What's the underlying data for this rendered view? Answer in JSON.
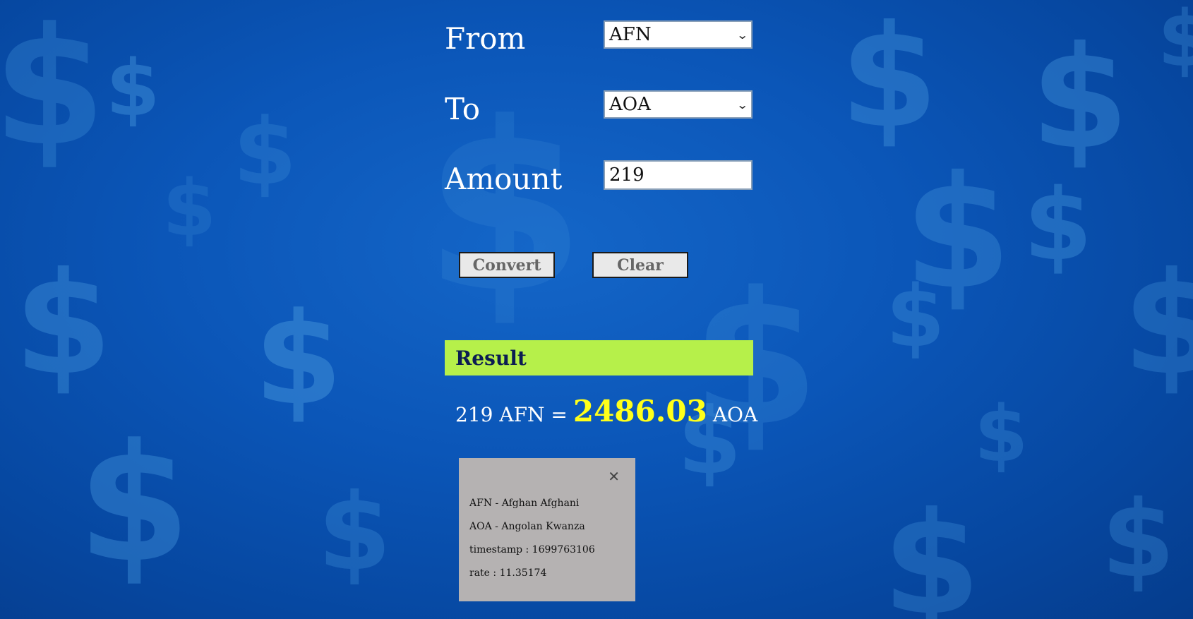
{
  "form": {
    "from_label": "From",
    "to_label": "To",
    "amount_label": "Amount",
    "from_value": "AFN",
    "to_value": "AOA",
    "amount_value": "219"
  },
  "buttons": {
    "convert_label": "Convert",
    "clear_label": "Clear"
  },
  "result": {
    "heading": "Result",
    "prefix": "219 AFN =",
    "value": "2486.03",
    "suffix": "AOA"
  },
  "info": {
    "close_symbol": "✕",
    "from_currency": "AFN - Afghan Afghani",
    "to_currency": "AOA - Angolan Kwanza",
    "timestamp": "timestamp : 1699763106",
    "rate": "rate : 11.35174"
  },
  "icons": {
    "select_arrow": "chevron-down-icon",
    "close": "close-icon",
    "background": "dollar-sign-icon"
  },
  "colors": {
    "background": "#0b56b8",
    "result_bar": "#b6f04a",
    "result_value": "#ffff1a",
    "info_box": "#b5b2b2"
  }
}
